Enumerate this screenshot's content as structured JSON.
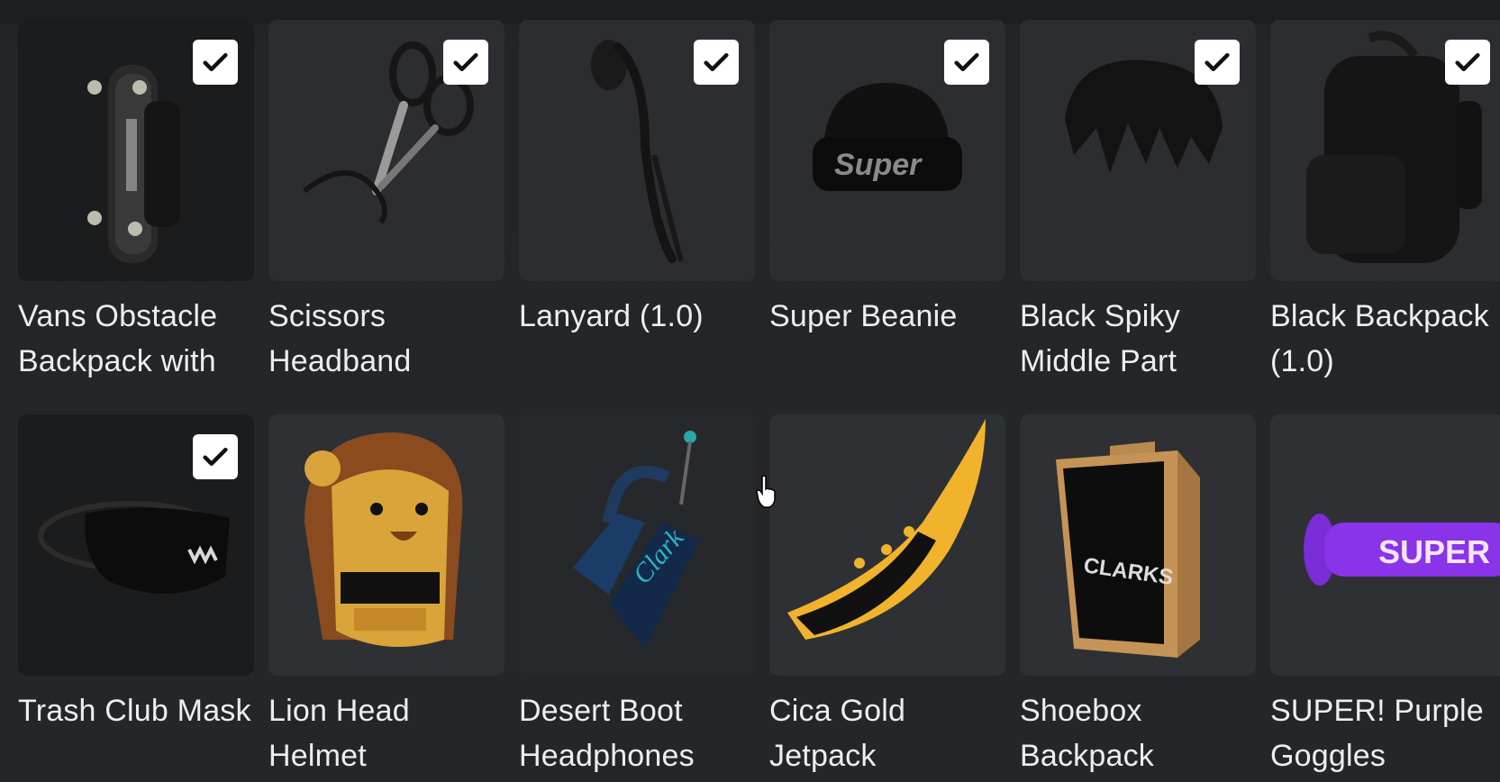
{
  "row1": [
    {
      "name": "Vans Obstacle Backpack with",
      "checked": true,
      "icon": "skateboard-backpack-icon"
    },
    {
      "name": "Scissors Headband",
      "checked": true,
      "icon": "scissors-headband-icon"
    },
    {
      "name": "Lanyard (1.0)",
      "checked": true,
      "icon": "lanyard-icon"
    },
    {
      "name": "Super Beanie",
      "checked": true,
      "icon": "beanie-icon"
    },
    {
      "name": "Black Spiky Middle Part",
      "checked": true,
      "icon": "hair-icon"
    },
    {
      "name": "Black Backpack (1.0)",
      "checked": true,
      "icon": "backpack-icon"
    }
  ],
  "row2": [
    {
      "name": "Trash Club Mask",
      "checked": true,
      "icon": "mask-icon"
    },
    {
      "name": "Lion Head Helmet",
      "checked": false,
      "icon": "lion-helmet-icon"
    },
    {
      "name": "Desert Boot Headphones",
      "checked": false,
      "icon": "headphones-icon"
    },
    {
      "name": "Cica Gold Jetpack",
      "checked": false,
      "icon": "jetpack-icon"
    },
    {
      "name": "Shoebox Backpack",
      "checked": false,
      "icon": "shoebox-icon"
    },
    {
      "name": "SUPER! Purple Goggles",
      "checked": false,
      "icon": "goggles-icon"
    }
  ],
  "art_text": {
    "beanie": "Super",
    "shoebox": "CLARKS",
    "goggles": "SUPER",
    "headphones": "Clark"
  },
  "colors": {
    "background": "#232527",
    "card": "#2b2d30",
    "text": "#eceff1",
    "check": "#ffffff"
  }
}
